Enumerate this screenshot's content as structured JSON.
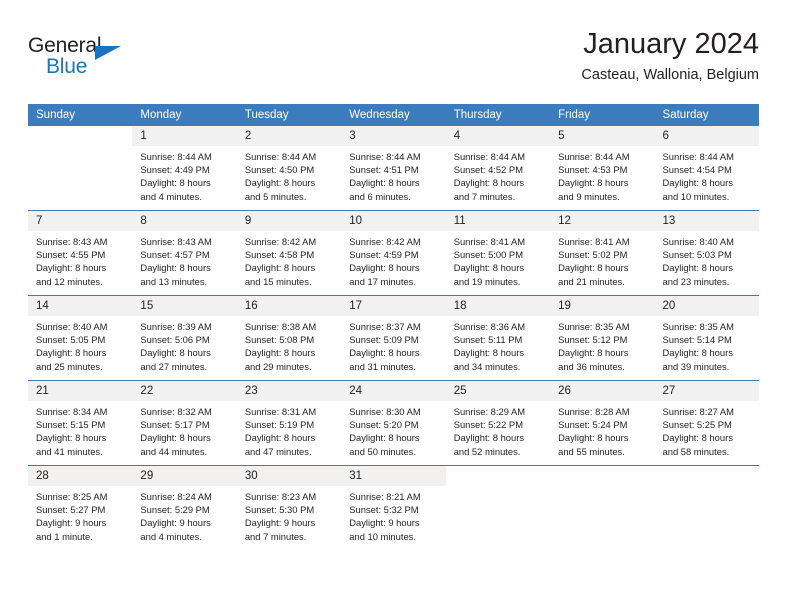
{
  "brand": {
    "name_top": "General",
    "name_bottom": "Blue",
    "accent_color": "#1b75bc"
  },
  "header": {
    "title": "January 2024",
    "subtitle": "Casteau, Wallonia, Belgium"
  },
  "theme": {
    "header_row_bg": "#3b7cbf",
    "header_row_text": "#ffffff",
    "daynum_bg": "#f1f1f1",
    "grid_line": "#3b7cbf",
    "text": "#231f20"
  },
  "calendar": {
    "weekday_headers": [
      "Sunday",
      "Monday",
      "Tuesday",
      "Wednesday",
      "Thursday",
      "Friday",
      "Saturday"
    ],
    "weeks": [
      [
        {
          "day": "",
          "sunrise": "",
          "sunset": "",
          "daylight": "",
          "daylight2": ""
        },
        {
          "day": "1",
          "sunrise": "Sunrise: 8:44 AM",
          "sunset": "Sunset: 4:49 PM",
          "daylight": "Daylight: 8 hours",
          "daylight2": "and 4 minutes."
        },
        {
          "day": "2",
          "sunrise": "Sunrise: 8:44 AM",
          "sunset": "Sunset: 4:50 PM",
          "daylight": "Daylight: 8 hours",
          "daylight2": "and 5 minutes."
        },
        {
          "day": "3",
          "sunrise": "Sunrise: 8:44 AM",
          "sunset": "Sunset: 4:51 PM",
          "daylight": "Daylight: 8 hours",
          "daylight2": "and 6 minutes."
        },
        {
          "day": "4",
          "sunrise": "Sunrise: 8:44 AM",
          "sunset": "Sunset: 4:52 PM",
          "daylight": "Daylight: 8 hours",
          "daylight2": "and 7 minutes."
        },
        {
          "day": "5",
          "sunrise": "Sunrise: 8:44 AM",
          "sunset": "Sunset: 4:53 PM",
          "daylight": "Daylight: 8 hours",
          "daylight2": "and 9 minutes."
        },
        {
          "day": "6",
          "sunrise": "Sunrise: 8:44 AM",
          "sunset": "Sunset: 4:54 PM",
          "daylight": "Daylight: 8 hours",
          "daylight2": "and 10 minutes."
        }
      ],
      [
        {
          "day": "7",
          "sunrise": "Sunrise: 8:43 AM",
          "sunset": "Sunset: 4:55 PM",
          "daylight": "Daylight: 8 hours",
          "daylight2": "and 12 minutes."
        },
        {
          "day": "8",
          "sunrise": "Sunrise: 8:43 AM",
          "sunset": "Sunset: 4:57 PM",
          "daylight": "Daylight: 8 hours",
          "daylight2": "and 13 minutes."
        },
        {
          "day": "9",
          "sunrise": "Sunrise: 8:42 AM",
          "sunset": "Sunset: 4:58 PM",
          "daylight": "Daylight: 8 hours",
          "daylight2": "and 15 minutes."
        },
        {
          "day": "10",
          "sunrise": "Sunrise: 8:42 AM",
          "sunset": "Sunset: 4:59 PM",
          "daylight": "Daylight: 8 hours",
          "daylight2": "and 17 minutes."
        },
        {
          "day": "11",
          "sunrise": "Sunrise: 8:41 AM",
          "sunset": "Sunset: 5:00 PM",
          "daylight": "Daylight: 8 hours",
          "daylight2": "and 19 minutes."
        },
        {
          "day": "12",
          "sunrise": "Sunrise: 8:41 AM",
          "sunset": "Sunset: 5:02 PM",
          "daylight": "Daylight: 8 hours",
          "daylight2": "and 21 minutes."
        },
        {
          "day": "13",
          "sunrise": "Sunrise: 8:40 AM",
          "sunset": "Sunset: 5:03 PM",
          "daylight": "Daylight: 8 hours",
          "daylight2": "and 23 minutes."
        }
      ],
      [
        {
          "day": "14",
          "sunrise": "Sunrise: 8:40 AM",
          "sunset": "Sunset: 5:05 PM",
          "daylight": "Daylight: 8 hours",
          "daylight2": "and 25 minutes."
        },
        {
          "day": "15",
          "sunrise": "Sunrise: 8:39 AM",
          "sunset": "Sunset: 5:06 PM",
          "daylight": "Daylight: 8 hours",
          "daylight2": "and 27 minutes."
        },
        {
          "day": "16",
          "sunrise": "Sunrise: 8:38 AM",
          "sunset": "Sunset: 5:08 PM",
          "daylight": "Daylight: 8 hours",
          "daylight2": "and 29 minutes."
        },
        {
          "day": "17",
          "sunrise": "Sunrise: 8:37 AM",
          "sunset": "Sunset: 5:09 PM",
          "daylight": "Daylight: 8 hours",
          "daylight2": "and 31 minutes."
        },
        {
          "day": "18",
          "sunrise": "Sunrise: 8:36 AM",
          "sunset": "Sunset: 5:11 PM",
          "daylight": "Daylight: 8 hours",
          "daylight2": "and 34 minutes."
        },
        {
          "day": "19",
          "sunrise": "Sunrise: 8:35 AM",
          "sunset": "Sunset: 5:12 PM",
          "daylight": "Daylight: 8 hours",
          "daylight2": "and 36 minutes."
        },
        {
          "day": "20",
          "sunrise": "Sunrise: 8:35 AM",
          "sunset": "Sunset: 5:14 PM",
          "daylight": "Daylight: 8 hours",
          "daylight2": "and 39 minutes."
        }
      ],
      [
        {
          "day": "21",
          "sunrise": "Sunrise: 8:34 AM",
          "sunset": "Sunset: 5:15 PM",
          "daylight": "Daylight: 8 hours",
          "daylight2": "and 41 minutes."
        },
        {
          "day": "22",
          "sunrise": "Sunrise: 8:32 AM",
          "sunset": "Sunset: 5:17 PM",
          "daylight": "Daylight: 8 hours",
          "daylight2": "and 44 minutes."
        },
        {
          "day": "23",
          "sunrise": "Sunrise: 8:31 AM",
          "sunset": "Sunset: 5:19 PM",
          "daylight": "Daylight: 8 hours",
          "daylight2": "and 47 minutes."
        },
        {
          "day": "24",
          "sunrise": "Sunrise: 8:30 AM",
          "sunset": "Sunset: 5:20 PM",
          "daylight": "Daylight: 8 hours",
          "daylight2": "and 50 minutes."
        },
        {
          "day": "25",
          "sunrise": "Sunrise: 8:29 AM",
          "sunset": "Sunset: 5:22 PM",
          "daylight": "Daylight: 8 hours",
          "daylight2": "and 52 minutes."
        },
        {
          "day": "26",
          "sunrise": "Sunrise: 8:28 AM",
          "sunset": "Sunset: 5:24 PM",
          "daylight": "Daylight: 8 hours",
          "daylight2": "and 55 minutes."
        },
        {
          "day": "27",
          "sunrise": "Sunrise: 8:27 AM",
          "sunset": "Sunset: 5:25 PM",
          "daylight": "Daylight: 8 hours",
          "daylight2": "and 58 minutes."
        }
      ],
      [
        {
          "day": "28",
          "sunrise": "Sunrise: 8:25 AM",
          "sunset": "Sunset: 5:27 PM",
          "daylight": "Daylight: 9 hours",
          "daylight2": "and 1 minute."
        },
        {
          "day": "29",
          "sunrise": "Sunrise: 8:24 AM",
          "sunset": "Sunset: 5:29 PM",
          "daylight": "Daylight: 9 hours",
          "daylight2": "and 4 minutes."
        },
        {
          "day": "30",
          "sunrise": "Sunrise: 8:23 AM",
          "sunset": "Sunset: 5:30 PM",
          "daylight": "Daylight: 9 hours",
          "daylight2": "and 7 minutes."
        },
        {
          "day": "31",
          "sunrise": "Sunrise: 8:21 AM",
          "sunset": "Sunset: 5:32 PM",
          "daylight": "Daylight: 9 hours",
          "daylight2": "and 10 minutes."
        },
        {
          "day": "",
          "sunrise": "",
          "sunset": "",
          "daylight": "",
          "daylight2": ""
        },
        {
          "day": "",
          "sunrise": "",
          "sunset": "",
          "daylight": "",
          "daylight2": ""
        },
        {
          "day": "",
          "sunrise": "",
          "sunset": "",
          "daylight": "",
          "daylight2": ""
        }
      ]
    ]
  }
}
